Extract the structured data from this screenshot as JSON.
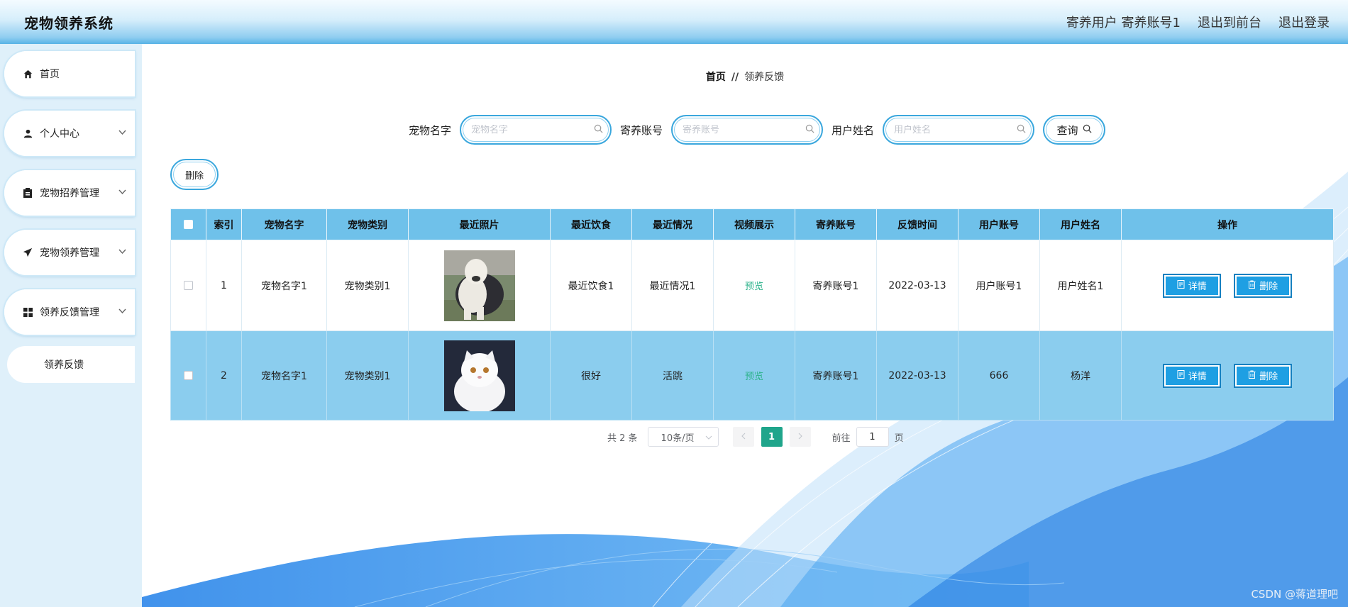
{
  "header": {
    "title": "宠物领养系统",
    "user_info": "寄养用户 寄养账号1",
    "to_front": "退出到前台",
    "logout": "退出登录"
  },
  "sidebar": {
    "items": [
      {
        "label": "首页",
        "icon": "home-icon"
      },
      {
        "label": "个人中心",
        "icon": "user-icon"
      },
      {
        "label": "宠物招养管理",
        "icon": "clipboard-icon"
      },
      {
        "label": "宠物领养管理",
        "icon": "paper-plane-icon"
      },
      {
        "label": "领养反馈管理",
        "icon": "grid-icon"
      }
    ],
    "sub_item": "领养反馈"
  },
  "breadcrumb": {
    "home": "首页",
    "separator": "//",
    "current": "领养反馈"
  },
  "search": {
    "pet_name_label": "宠物名字",
    "pet_name_placeholder": "宠物名字",
    "foster_account_label": "寄养账号",
    "foster_account_placeholder": "寄养账号",
    "user_name_label": "用户姓名",
    "user_name_placeholder": "用户姓名",
    "query_label": "查询"
  },
  "toolbar": {
    "delete_label": "删除"
  },
  "table": {
    "headers": [
      "索引",
      "宠物名字",
      "宠物类别",
      "最近照片",
      "最近饮食",
      "最近情况",
      "视频展示",
      "寄养账号",
      "反馈时间",
      "用户账号",
      "用户姓名",
      "操作"
    ],
    "rows": [
      {
        "index": "1",
        "pet_name": "宠物名字1",
        "pet_category": "宠物类别1",
        "diet": "最近饮食1",
        "condition": "最近情况1",
        "video": "预览",
        "foster_account": "寄养账号1",
        "time": "2022-03-13",
        "user_account": "用户账号1",
        "user_name": "用户姓名1"
      },
      {
        "index": "2",
        "pet_name": "宠物名字1",
        "pet_category": "宠物类别1",
        "diet": "很好",
        "condition": "活跳",
        "video": "预览",
        "foster_account": "寄养账号1",
        "time": "2022-03-13",
        "user_account": "666",
        "user_name": "杨洋"
      }
    ],
    "detail_label": "详情",
    "delete_label": "删除"
  },
  "pagination": {
    "total": "共 2 条",
    "page_size": "10条/页",
    "current_page": "1",
    "goto_prefix": "前往",
    "goto_value": "1",
    "goto_suffix": "页"
  },
  "watermark": "CSDN @蒋道理吧",
  "colors": {
    "accent": "#1e9fe3",
    "header_row": "#6fc1ea",
    "pager_active": "#1fa58b"
  }
}
